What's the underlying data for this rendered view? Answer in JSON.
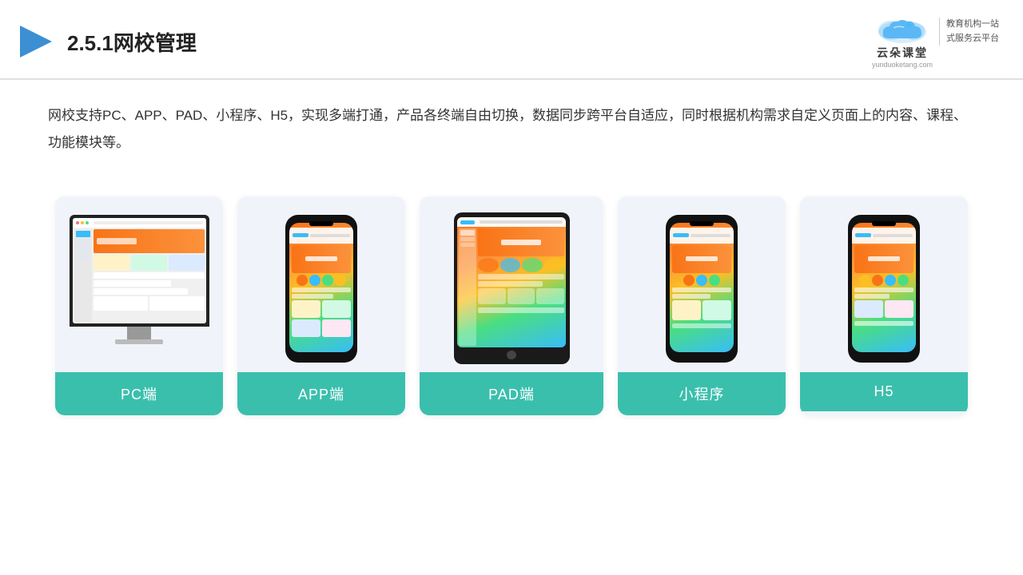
{
  "header": {
    "title": "2.5.1网校管理",
    "logo_name": "云朵课堂",
    "logo_url": "yunduoketang.com",
    "logo_slogan": "教育机构一站\n式服务云平台"
  },
  "description": {
    "text": "网校支持PC、APP、PAD、小程序、H5，实现多端打通，产品各终端自由切换，数据同步跨平台自适应，同时根据机构需求自定义页面上的内容、课程、功能模块等。"
  },
  "cards": [
    {
      "id": "pc",
      "label": "PC端",
      "type": "pc"
    },
    {
      "id": "app",
      "label": "APP端",
      "type": "phone"
    },
    {
      "id": "pad",
      "label": "PAD端",
      "type": "pad"
    },
    {
      "id": "miniapp",
      "label": "小程序",
      "type": "phone"
    },
    {
      "id": "h5",
      "label": "H5",
      "type": "phone"
    }
  ],
  "colors": {
    "accent": "#3bbfad",
    "title_blue": "#1a2e6e",
    "bg_card": "#f0f4fa"
  }
}
